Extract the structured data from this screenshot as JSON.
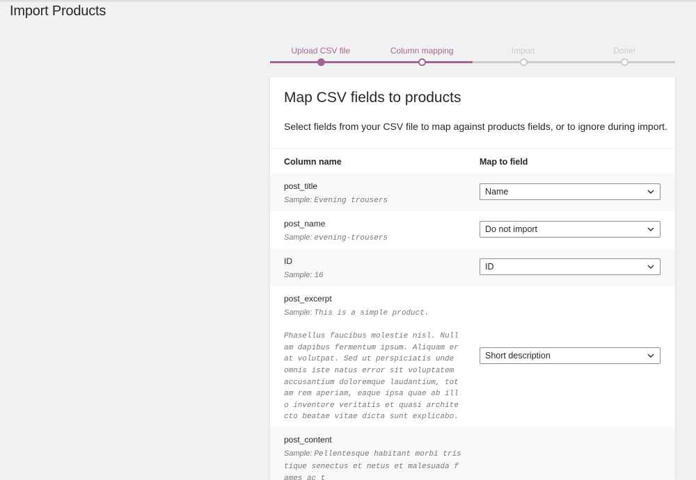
{
  "page": {
    "title": "Import Products"
  },
  "steps": [
    {
      "label": "Upload CSV file",
      "state": "done"
    },
    {
      "label": "Column mapping",
      "state": "active"
    },
    {
      "label": "Import",
      "state": "todo"
    },
    {
      "label": "Done!",
      "state": "todo"
    }
  ],
  "card": {
    "title": "Map CSV fields to products",
    "description": "Select fields from your CSV file to map against products fields, or to ignore during import.",
    "col_name_header": "Column name",
    "map_header": "Map to field"
  },
  "rows": [
    {
      "name": "post_title",
      "sample_prefix": "Sample:",
      "sample": "Evening trousers",
      "extra": "",
      "mapped": "Name"
    },
    {
      "name": "post_name",
      "sample_prefix": "Sample:",
      "sample": "evening-trousers",
      "extra": "",
      "mapped": "Do not import"
    },
    {
      "name": "ID",
      "sample_prefix": "Sample:",
      "sample": "16",
      "extra": "",
      "mapped": "ID"
    },
    {
      "name": "post_excerpt",
      "sample_prefix": "Sample:",
      "sample": "This is a simple product.",
      "extra": "Phasellus faucibus molestie nisl. Nullam dapibus fermentum ipsum. Aliquam erat volutpat. Sed ut perspiciatis unde omnis iste natus error sit voluptatem accusantium doloremque laudantium, totam rem aperiam, eaque ipsa quae ab illo inventore veritatis et quasi architecto beatae vitae dicta sunt explicabo.",
      "mapped": "Short description"
    },
    {
      "name": "post_content",
      "sample_prefix": "Sample:",
      "sample": "Pellentesque habitant morbi tristique senectus et netus et malesuada fames ac t",
      "extra": "",
      "mapped": ""
    }
  ],
  "icons": {
    "dropdown": "chevron-down-icon"
  },
  "colors": {
    "accent": "#a16696",
    "inactive": "#cccccc",
    "alt_row": "#f8f8f8"
  }
}
